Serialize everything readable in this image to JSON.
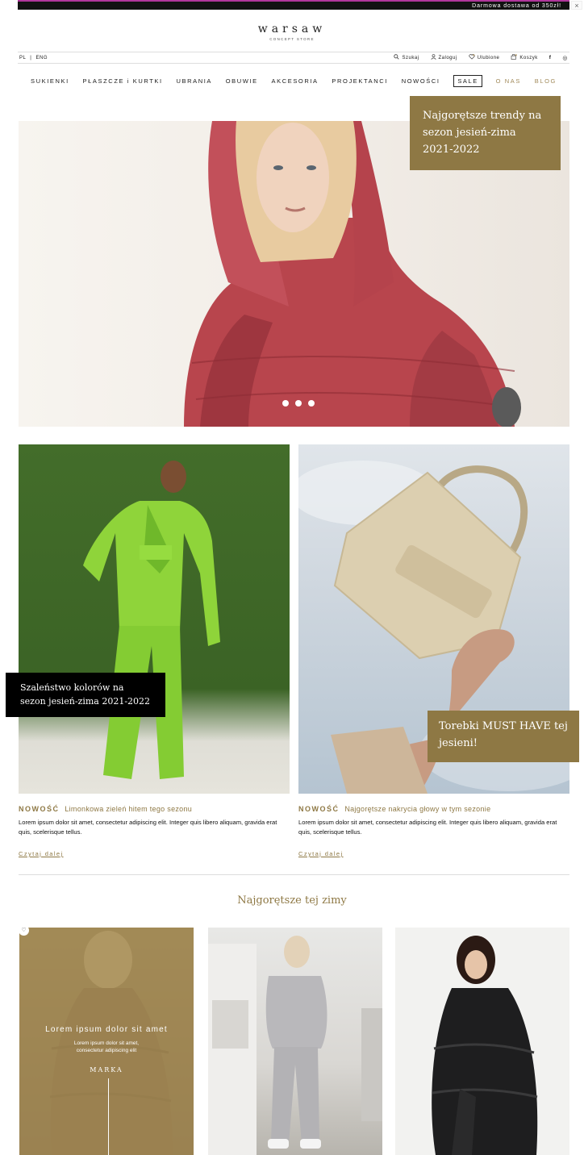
{
  "topbar": {
    "text": "Darmowa dostawa od 350zł!",
    "close": "×"
  },
  "logo": {
    "name": "warsaw",
    "tagline": "CONCEPT STORE"
  },
  "utility": {
    "lang_pl": "PL",
    "lang_sep": "|",
    "lang_en": "ENG",
    "search": "Szukaj",
    "login": "Zaloguj",
    "favorites": "Ulubione",
    "cart": "Koszyk",
    "facebook": "f",
    "instagram": "◎"
  },
  "nav": {
    "items": [
      "SUKIENKI",
      "PŁASZCZE i KURTKI",
      "UBRANIA",
      "OBUWIE",
      "AKCESORIA",
      "PROJEKTANCI",
      "NOWOŚCI"
    ],
    "sale": "SALE",
    "about": "O NAS",
    "blog": "BLOG"
  },
  "hero": {
    "caption": "Najgorętsze trendy na sezon jesień-zima 2021-2022"
  },
  "promos": {
    "left_caption": "Szaleństwo kolorów na sezon jesień-zima 2021-2022",
    "right_caption": "Torebki MUST HAVE tej jesieni!"
  },
  "articles": [
    {
      "badge": "NOWOŚĆ",
      "title": "Limonkowa zieleń hitem tego sezonu",
      "text": "Lorem ipsum dolor sit amet, consectetur adipiscing elit. Integer quis libero aliquam, gravida erat quis, scelerisque tellus.",
      "link": "Czytaj dalej"
    },
    {
      "badge": "NOWOŚĆ",
      "title": "Najgorętsze nakrycia głowy w tym sezonie",
      "text": "Lorem ipsum dolor sit amet, consectetur adipiscing elit. Integer quis libero aliquam, gravida erat quis, scelerisque tellus.",
      "link": "Czytaj dalej"
    }
  ],
  "section": {
    "title": "Najgorętsze tej zimy"
  },
  "product_overlay": {
    "title": "Lorem ipsum dolor sit amet",
    "desc_line1": "Lorem ipsum dolor sit amet,",
    "desc_line2": "consectetur adipiscing elit",
    "brand": "MARKA"
  },
  "colors": {
    "accent_gold": "#8e7844",
    "nav_gold": "#a18a5a",
    "topbar_bg": "#111111"
  }
}
